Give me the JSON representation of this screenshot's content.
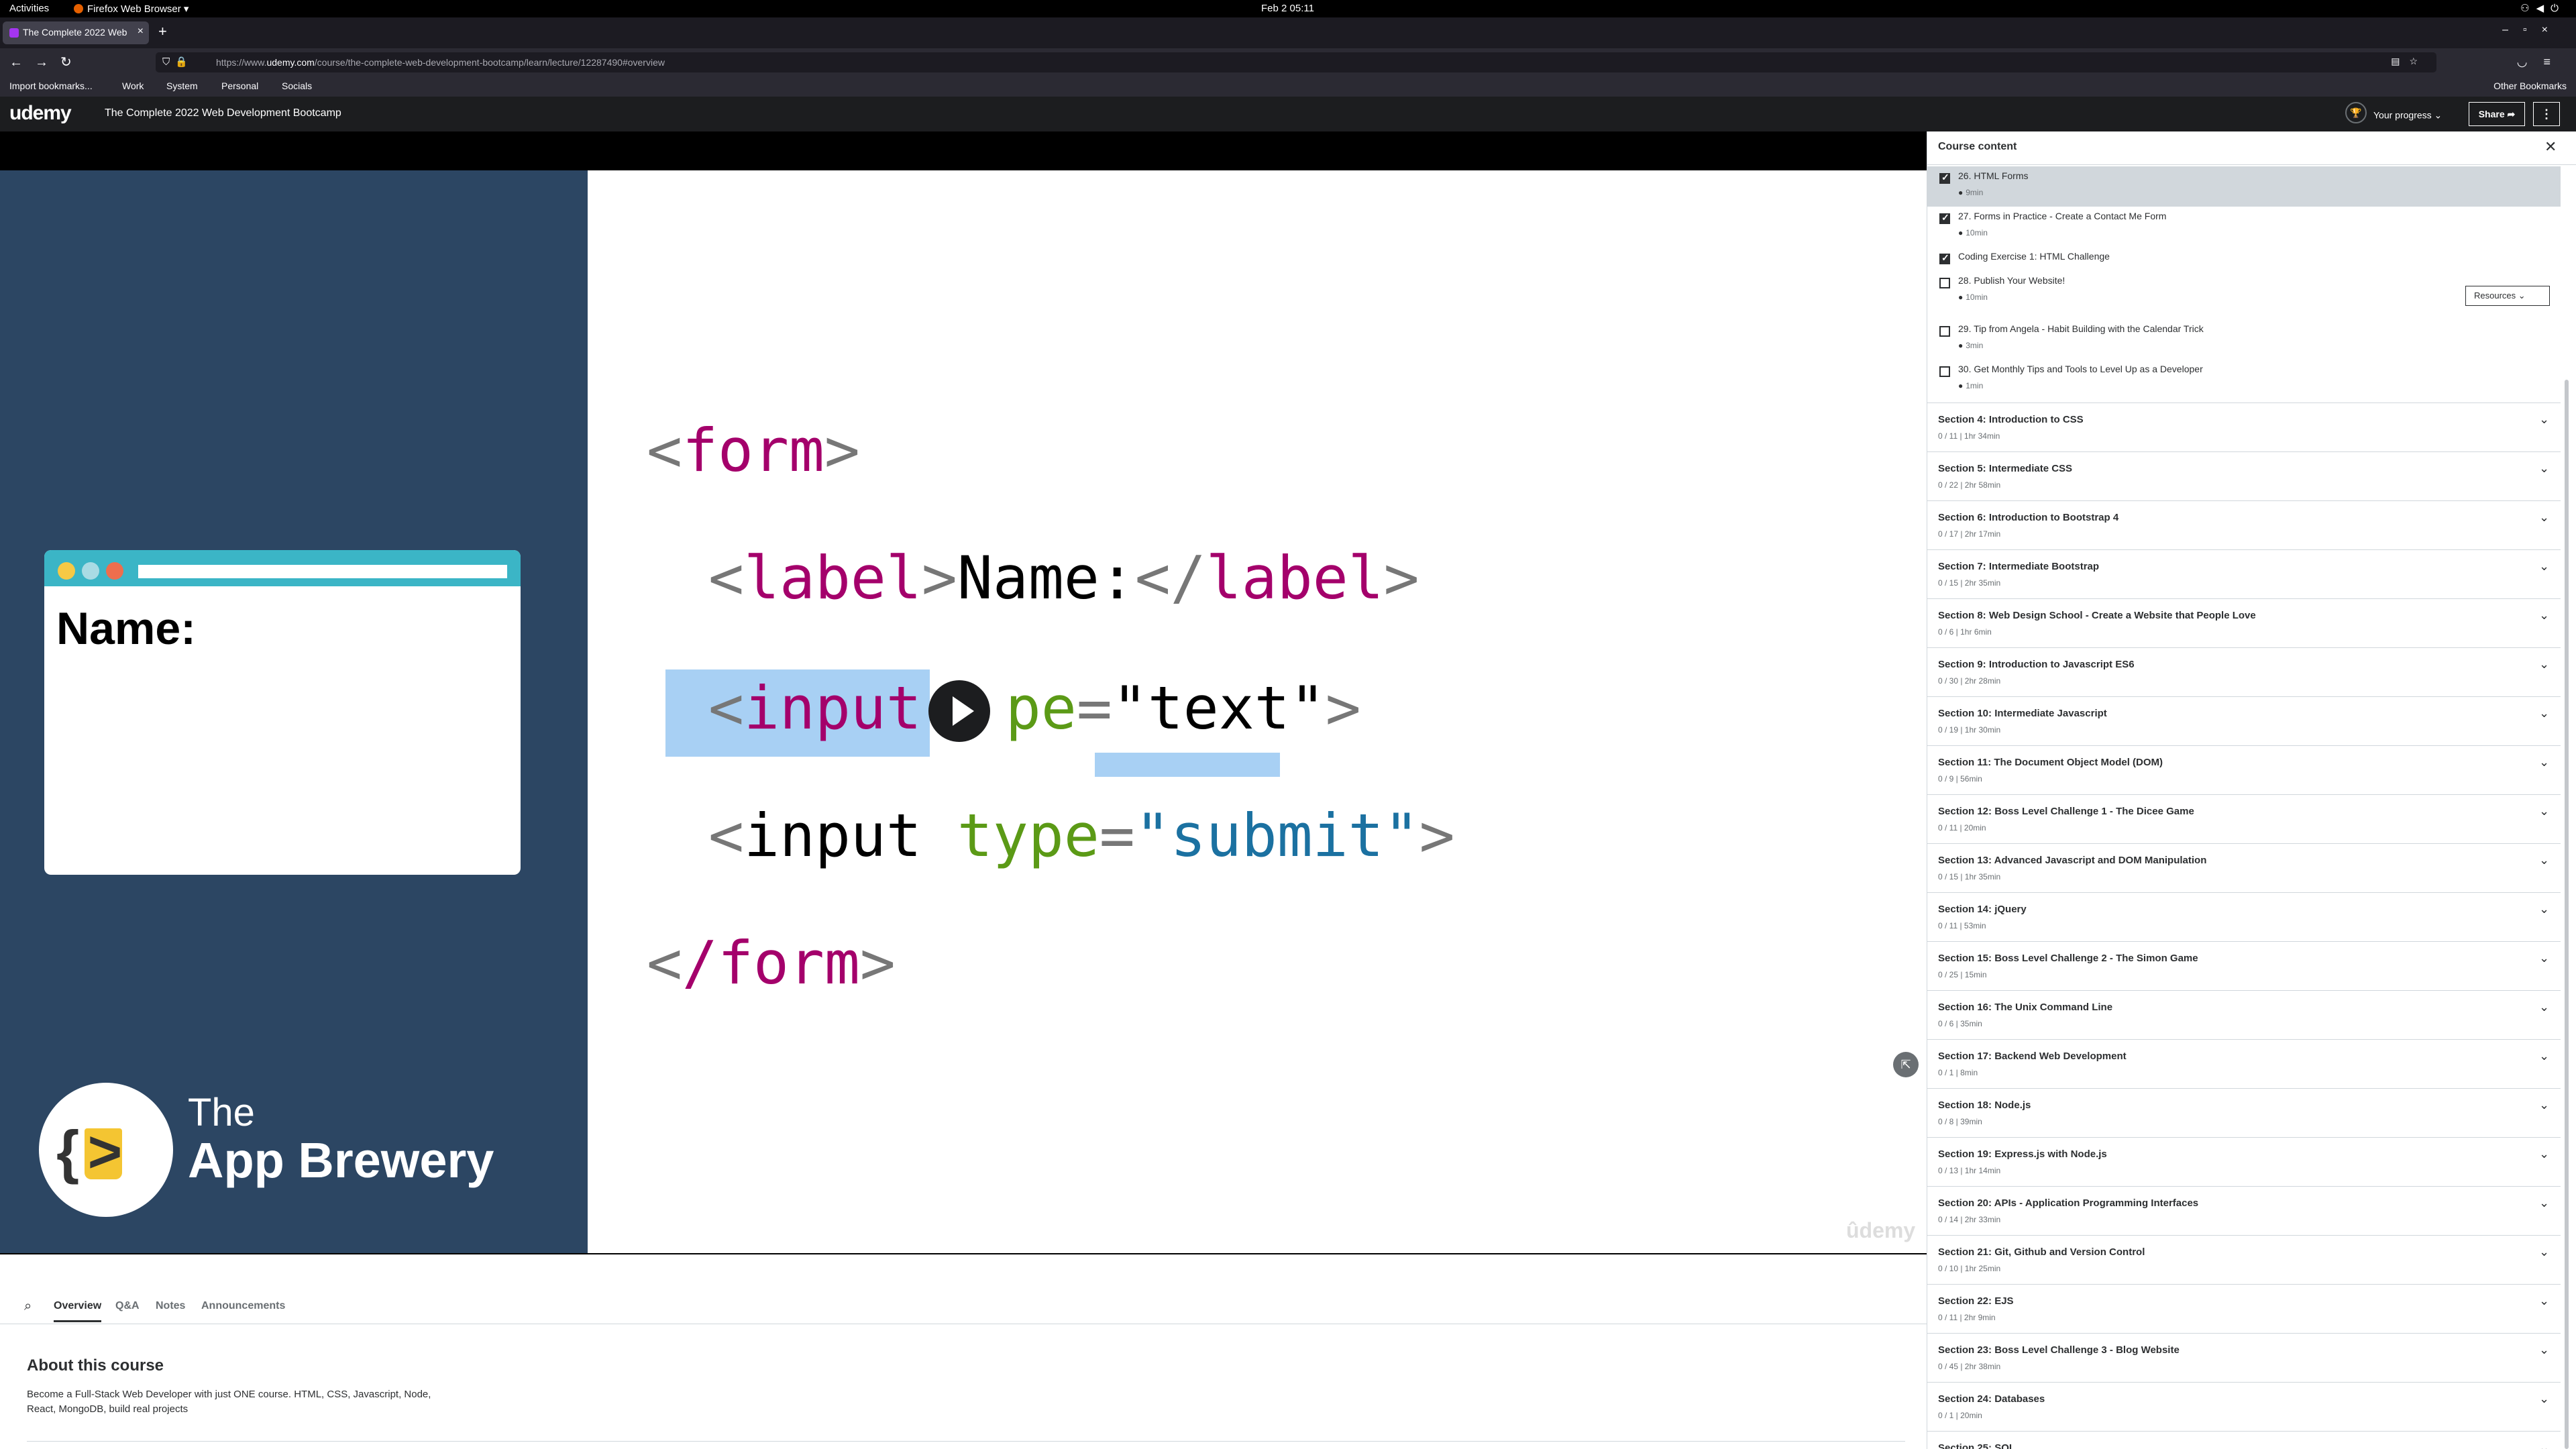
{
  "system": {
    "activities": "Activities",
    "app": "Firefox Web Browser ▾",
    "clock": "Feb 2 05:11"
  },
  "browser": {
    "tab_title": "The Complete 2022 Web",
    "url_prefix": "https://www.",
    "url_domain": "udemy.com",
    "url_path": "/course/the-complete-web-development-bootcamp/learn/lecture/12287490#overview",
    "bookmarks": [
      "Import bookmarks...",
      "Work",
      "System",
      "Personal",
      "Socials"
    ],
    "other_bookmarks": "Other Bookmarks"
  },
  "header": {
    "logo": "udemy",
    "course_title": "The Complete 2022 Web Development Bootcamp",
    "progress_label": "Your progress",
    "share_label": "Share"
  },
  "video": {
    "name_label": "Name:",
    "brand_line1": "The",
    "brand_line2": "App Brewery",
    "watermark": "ûdemy",
    "code": {
      "form_open": "form",
      "label_tag": "label",
      "label_text": "Name:",
      "input_tag": "input",
      "type_partial": "pe",
      "type_attr": "type",
      "text_value": "\"text\"",
      "submit_value": "\"submit\"",
      "form_close": "/form"
    }
  },
  "lower_tabs": [
    "Overview",
    "Q&A",
    "Notes",
    "Announcements"
  ],
  "about": {
    "title": "About this course",
    "description": "Become a Full-Stack Web Developer with just ONE course. HTML, CSS, Javascript, Node, React, MongoDB, build real projects"
  },
  "sidebar": {
    "title": "Course content",
    "resources_label": "Resources",
    "lectures": [
      {
        "title": "26. HTML Forms",
        "duration": "9min",
        "checked": true,
        "active": true
      },
      {
        "title": "27. Forms in Practice - Create a Contact Me Form",
        "duration": "10min",
        "checked": true,
        "active": false
      },
      {
        "title": "Coding Exercise 1: HTML Challenge",
        "duration": "",
        "checked": true,
        "active": false
      },
      {
        "title": "28. Publish Your Website!",
        "duration": "10min",
        "checked": false,
        "active": false,
        "resources": true
      },
      {
        "title": "29. Tip from Angela - Habit Building with the Calendar Trick",
        "duration": "3min",
        "checked": false,
        "active": false
      },
      {
        "title": "30. Get Monthly Tips and Tools to Level Up as a Developer",
        "duration": "1min",
        "checked": false,
        "active": false
      }
    ],
    "sections": [
      {
        "title": "Section 4: Introduction to CSS",
        "sub": "0 / 11 | 1hr 34min"
      },
      {
        "title": "Section 5: Intermediate CSS",
        "sub": "0 / 22 | 2hr 58min"
      },
      {
        "title": "Section 6: Introduction to Bootstrap 4",
        "sub": "0 / 17 | 2hr 17min"
      },
      {
        "title": "Section 7: Intermediate Bootstrap",
        "sub": "0 / 15 | 2hr 35min"
      },
      {
        "title": "Section 8: Web Design School - Create a Website that People Love",
        "sub": "0 / 6 | 1hr 6min"
      },
      {
        "title": "Section 9: Introduction to Javascript ES6",
        "sub": "0 / 30 | 2hr 28min"
      },
      {
        "title": "Section 10: Intermediate Javascript",
        "sub": "0 / 19 | 1hr 30min"
      },
      {
        "title": "Section 11: The Document Object Model (DOM)",
        "sub": "0 / 9 | 56min"
      },
      {
        "title": "Section 12: Boss Level Challenge 1 - The Dicee Game",
        "sub": "0 / 11 | 20min"
      },
      {
        "title": "Section 13: Advanced Javascript and DOM Manipulation",
        "sub": "0 / 15 | 1hr 35min"
      },
      {
        "title": "Section 14: jQuery",
        "sub": "0 / 11 | 53min"
      },
      {
        "title": "Section 15: Boss Level Challenge 2 - The Simon Game",
        "sub": "0 / 25 | 15min"
      },
      {
        "title": "Section 16: The Unix Command Line",
        "sub": "0 / 6 | 35min"
      },
      {
        "title": "Section 17: Backend Web Development",
        "sub": "0 / 1 | 8min"
      },
      {
        "title": "Section 18: Node.js",
        "sub": "0 / 8 | 39min"
      },
      {
        "title": "Section 19: Express.js with Node.js",
        "sub": "0 / 13 | 1hr 14min"
      },
      {
        "title": "Section 20: APIs - Application Programming Interfaces",
        "sub": "0 / 14 | 2hr 33min"
      },
      {
        "title": "Section 21: Git, Github and Version Control",
        "sub": "0 / 10 | 1hr 25min"
      },
      {
        "title": "Section 22: EJS",
        "sub": "0 / 11 | 2hr 9min"
      },
      {
        "title": "Section 23: Boss Level Challenge 3 - Blog Website",
        "sub": "0 / 45 | 2hr 38min"
      },
      {
        "title": "Section 24: Databases",
        "sub": "0 / 1 | 20min"
      },
      {
        "title": "Section 25: SQL",
        "sub": ""
      }
    ]
  }
}
